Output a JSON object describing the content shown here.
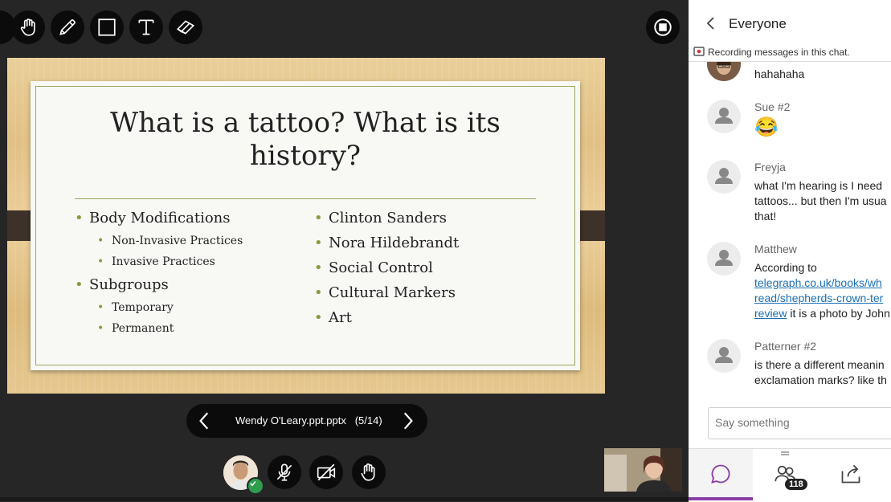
{
  "toolbar": {
    "tools": [
      {
        "icon": "hand-icon"
      },
      {
        "icon": "pencil-icon"
      },
      {
        "icon": "rectangle-icon"
      },
      {
        "icon": "text-icon"
      },
      {
        "icon": "eraser-icon"
      }
    ],
    "stop_icon": "stop-share-icon"
  },
  "slide": {
    "title": "What is a tattoo? What is its history?",
    "left_bullets": [
      {
        "label": "Body Modifications",
        "level": 1
      },
      {
        "label": "Non-Invasive Practices",
        "level": 2
      },
      {
        "label": "Invasive Practices",
        "level": 2
      },
      {
        "label": "Subgroups",
        "level": 1
      },
      {
        "label": "Temporary",
        "level": 2
      },
      {
        "label": "Permanent",
        "level": 2
      }
    ],
    "right_bullets": [
      {
        "label": "Clinton Sanders",
        "level": 1
      },
      {
        "label": "Nora Hildebrandt",
        "level": 1
      },
      {
        "label": "Social Control",
        "level": 1
      },
      {
        "label": "Cultural Markers",
        "level": 1
      },
      {
        "label": "Art",
        "level": 1
      }
    ],
    "accent_color": "#8a9a3e"
  },
  "slide_nav": {
    "file_name": "Wendy O'Leary.ppt.pptx",
    "page_indicator": "(5/14)"
  },
  "controls": [
    {
      "icon": "microphone-muted-icon"
    },
    {
      "icon": "camera-off-icon"
    },
    {
      "icon": "raise-hand-icon"
    }
  ],
  "chat": {
    "title": "Everyone",
    "recording_notice": "Recording messages in this chat.",
    "messages": [
      {
        "author": "",
        "text": "hahahaha",
        "emoji": ""
      },
      {
        "author": "Sue #2",
        "text": "",
        "emoji": "😂"
      },
      {
        "author": "Freyja",
        "text": "what I'm hearing is I need\ntattoos... but then I'm usua\nthat!"
      },
      {
        "author": "Matthew",
        "text_before": "According to",
        "link": "telegraph.co.uk/books/wh\nread/shepherds-crown-ter\nreview",
        "text_after": " it is a photo by John"
      },
      {
        "author": "Patterner #2",
        "text": "is there a different meanin\nexclamation marks? like th"
      }
    ],
    "composer_placeholder": "Say something",
    "attendee_count": "118",
    "active_color": "#8a3fa6"
  }
}
